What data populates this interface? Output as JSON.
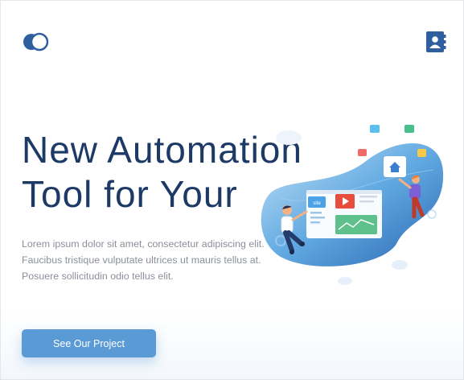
{
  "header": {
    "logo_icon": "toggle-logo-icon",
    "contacts_icon": "contacts-book-icon",
    "accent": "#2f5f9e"
  },
  "hero": {
    "title_line1": "New Automation",
    "title_line2": "Tool for Your",
    "description": "Lorem ipsum dolor sit amet, consectetur adipiscing elit. Faucibus tristique vulputate ultrices ut mauris tellus at. Posuere sollicitudin odio tellus elit.",
    "cta_label": "See Our Project",
    "title_color": "#1d3a66",
    "cta_color": "#5b9bd5"
  },
  "illustration": {
    "screen_label": "site",
    "icons": [
      "home-icon",
      "play-icon",
      "settings-icon",
      "camera-icon",
      "bulb-icon",
      "briefcase-icon"
    ]
  }
}
